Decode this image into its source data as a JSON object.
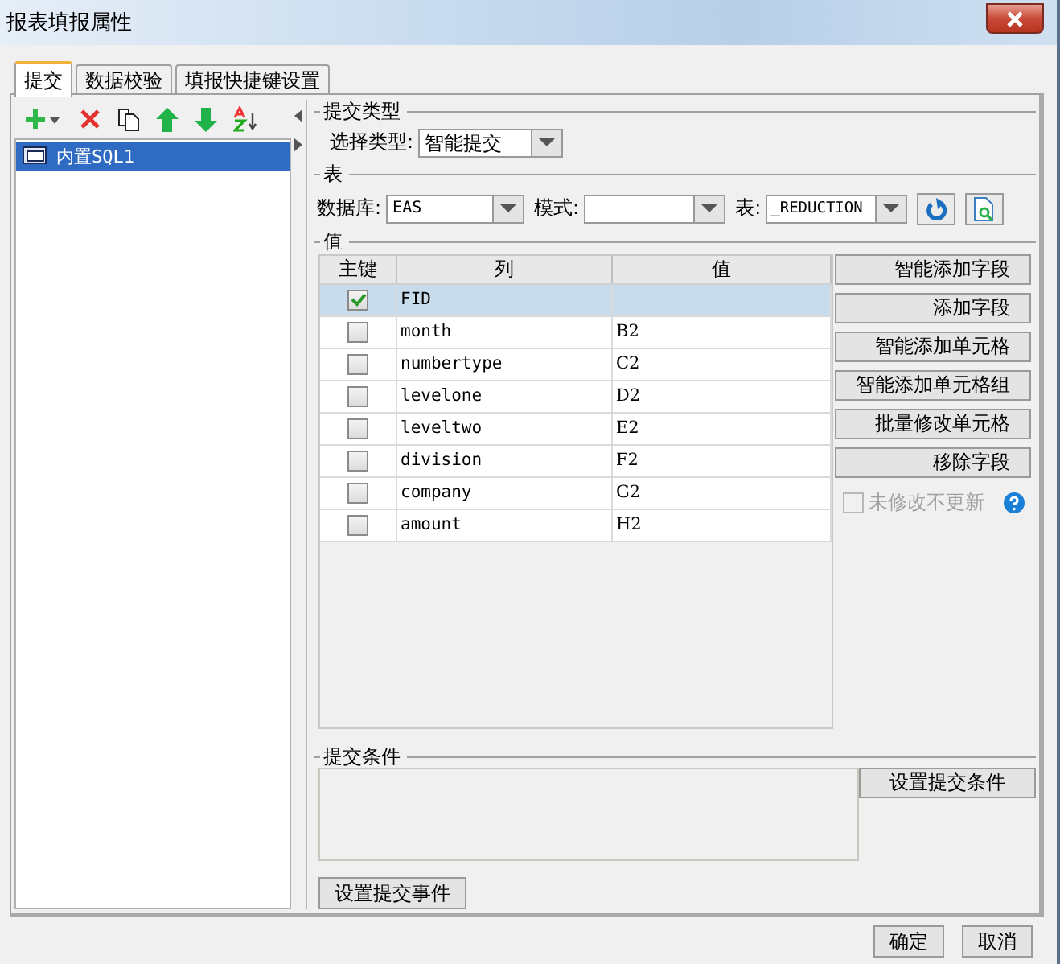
{
  "window": {
    "title": "报表填报属性"
  },
  "tabs": [
    {
      "label": "提交",
      "selected": true
    },
    {
      "label": "数据校验",
      "selected": false
    },
    {
      "label": "填报快捷键设置",
      "selected": false
    }
  ],
  "tree": {
    "items": [
      {
        "label": "内置SQL1",
        "selected": true
      }
    ]
  },
  "submit_type": {
    "label": "提交类型",
    "field_label": "选择类型:",
    "value": "智能提交"
  },
  "table_section": {
    "label": "表",
    "database_label": "数据库:",
    "database": "EAS",
    "schema_label": "模式:",
    "table_label": "表:",
    "table": "_REDUCTION"
  },
  "values": {
    "label": "值",
    "columns": [
      "主键",
      "列",
      "值"
    ],
    "rows": [
      {
        "primary_key": true,
        "column": "FID",
        "selected": true
      },
      {
        "primary_key": false,
        "column": "month",
        "value": "B2",
        "selected": false
      },
      {
        "primary_key": false,
        "column": "numbertype",
        "value": "C2",
        "selected": false
      },
      {
        "primary_key": false,
        "column": "levelone",
        "value": "D2",
        "selected": false
      },
      {
        "primary_key": false,
        "column": "leveltwo",
        "value": "E2",
        "selected": false
      },
      {
        "primary_key": false,
        "column": "division",
        "value": "F2",
        "selected": false
      },
      {
        "primary_key": false,
        "column": "company",
        "value": "G2",
        "selected": false
      },
      {
        "primary_key": false,
        "column": "amount",
        "value": "H2",
        "selected": false
      }
    ],
    "buttons": [
      "智能添加字段",
      "添加字段",
      "智能添加单元格",
      "智能添加单元格组",
      "批量修改单元格",
      "移除字段"
    ],
    "no_update_unchanged": {
      "label": "未修改不更新",
      "checked": false,
      "disabled": true
    }
  },
  "condition": {
    "label": "提交条件",
    "button": "设置提交条件"
  },
  "event_button": "设置提交事件",
  "buttons": [
    "确定",
    "取消"
  ]
}
